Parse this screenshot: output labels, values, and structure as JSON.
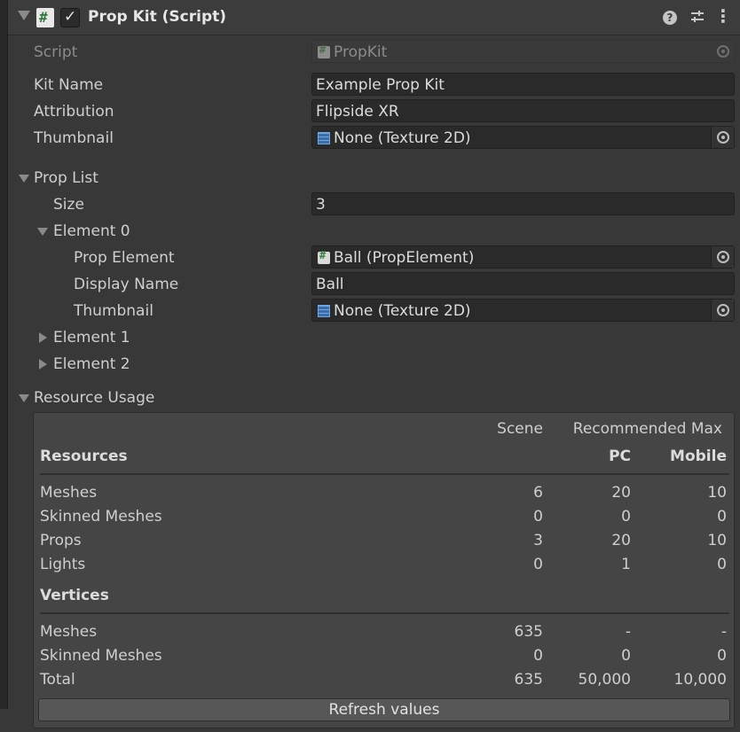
{
  "component": {
    "title": "Prop Kit (Script)",
    "enabled": true
  },
  "fields": {
    "script": {
      "label": "Script",
      "value": "PropKit"
    },
    "kit_name": {
      "label": "Kit Name",
      "value": "Example Prop Kit"
    },
    "attribution": {
      "label": "Attribution",
      "value": "Flipside XR"
    },
    "thumbnail": {
      "label": "Thumbnail",
      "value": "None (Texture 2D)"
    }
  },
  "prop_list": {
    "label": "Prop List",
    "size_label": "Size",
    "size_value": "3",
    "elements": [
      {
        "label": "Element 0",
        "expanded": true,
        "prop_element": {
          "label": "Prop Element",
          "value": "Ball (PropElement)"
        },
        "display_name": {
          "label": "Display Name",
          "value": "Ball"
        },
        "thumbnail": {
          "label": "Thumbnail",
          "value": "None (Texture 2D)"
        }
      },
      {
        "label": "Element 1",
        "expanded": false
      },
      {
        "label": "Element 2",
        "expanded": false
      }
    ]
  },
  "resource_usage": {
    "label": "Resource Usage",
    "col_scene": "Scene",
    "col_recommended": "Recommended Max",
    "col_pc": "PC",
    "col_mobile": "Mobile",
    "resources_heading": "Resources",
    "vertices_heading": "Vertices",
    "resources": [
      {
        "name": "Meshes",
        "scene": "6",
        "pc": "20",
        "mobile": "10"
      },
      {
        "name": "Skinned Meshes",
        "scene": "0",
        "pc": "0",
        "mobile": "0"
      },
      {
        "name": "Props",
        "scene": "3",
        "pc": "20",
        "mobile": "10"
      },
      {
        "name": "Lights",
        "scene": "0",
        "pc": "1",
        "mobile": "0"
      }
    ],
    "vertices": [
      {
        "name": "Meshes",
        "scene": "635",
        "pc": "-",
        "mobile": "-"
      },
      {
        "name": "Skinned Meshes",
        "scene": "0",
        "pc": "0",
        "mobile": "0"
      },
      {
        "name": "Total",
        "scene": "635",
        "pc": "50,000",
        "mobile": "10,000"
      }
    ],
    "refresh_label": "Refresh values"
  }
}
